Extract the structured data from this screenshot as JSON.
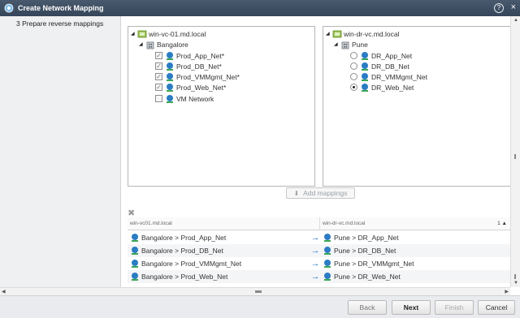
{
  "window": {
    "title": "Create Network Mapping",
    "help_glyph": "?",
    "close_glyph": "×"
  },
  "wizard": {
    "step_label": "3  Prepare reverse mappings"
  },
  "left_tree": {
    "root": "win-vc-01.md.local",
    "datacenter": "Bangalore",
    "networks": [
      {
        "label": "Prod_App_Net*",
        "checked": true
      },
      {
        "label": "Prod_DB_Net*",
        "checked": true
      },
      {
        "label": "Prod_VMMgmt_Net*",
        "checked": true
      },
      {
        "label": "Prod_Web_Net*",
        "checked": true
      },
      {
        "label": "VM Network",
        "checked": false
      }
    ]
  },
  "right_tree": {
    "root": "win-dr-vc.md.local",
    "datacenter": "Pune",
    "networks": [
      {
        "label": "DR_App_Net",
        "selected": false
      },
      {
        "label": "DR_DB_Net",
        "selected": false
      },
      {
        "label": "DR_VMMgmt_Net",
        "selected": false
      },
      {
        "label": "DR_Web_Net",
        "selected": true
      }
    ]
  },
  "add_mappings_label": "Add mappings",
  "mappings_grid": {
    "columns": [
      "win-vc01.md.local",
      "win-dr-vc.md.local"
    ],
    "sort_indicator": "1 ▲",
    "rows": [
      {
        "source": "Bangalore > Prod_App_Net",
        "target": "Pune > DR_App_Net"
      },
      {
        "source": "Bangalore > Prod_DB_Net",
        "target": "Pune > DR_DB_Net"
      },
      {
        "source": "Bangalore > Prod_VMMgmt_Net",
        "target": "Pune > DR_VMMgmt_Net"
      },
      {
        "source": "Bangalore > Prod_Web_Net",
        "target": "Pune > DR_Web_Net"
      }
    ]
  },
  "footer": {
    "back": "Back",
    "next": "Next",
    "finish": "Finish",
    "cancel": "Cancel"
  },
  "colors": {
    "titlebar": "#3f4e63",
    "accent_arrow": "#1d75c6",
    "network_icon": "#2b7cc4"
  }
}
